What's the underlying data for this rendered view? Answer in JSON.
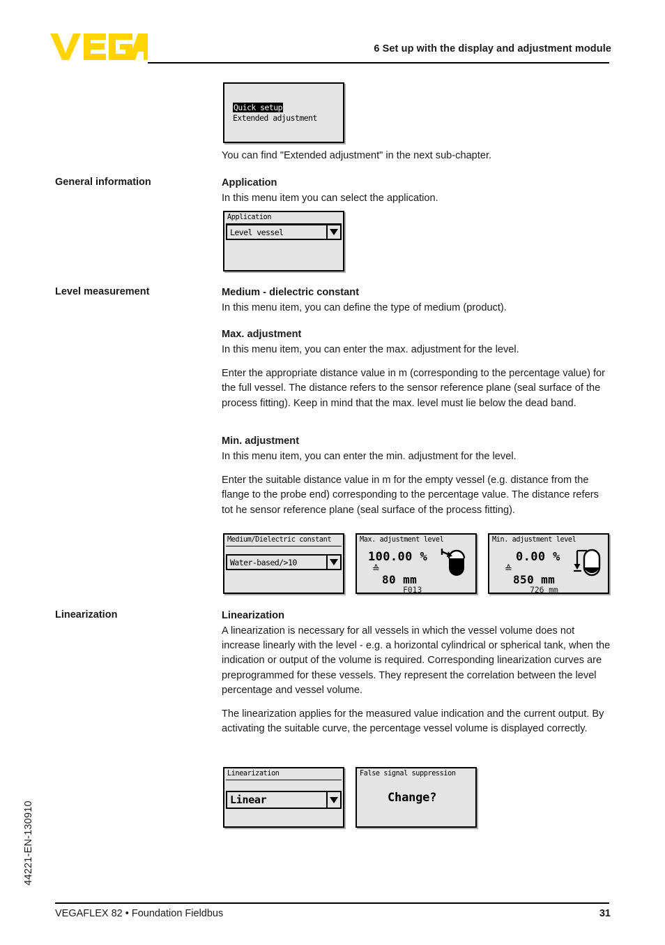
{
  "header": {
    "logo_text": "VEGA",
    "logo_color": "#FFD400",
    "chapter_title": "6 Set up with the display and adjustment module"
  },
  "displays": {
    "quick_setup": {
      "items": [
        {
          "label": "Quick setup",
          "selected": true
        },
        {
          "label": "Extended adjustment",
          "selected": false
        }
      ]
    },
    "application": {
      "title": "Application",
      "value": "Level vessel",
      "caret_icon": "chevron-down-icon"
    },
    "medium": {
      "title": "Medium/Dielectric constant",
      "value": "Water-based/>10",
      "caret_icon": "chevron-down-icon"
    },
    "max_adjustment": {
      "title": "Max. adjustment level",
      "percent": "100.00 %",
      "equiv": "≙",
      "distance": "80  mm",
      "code": "F013",
      "vessel_icon": "vessel-full-icon"
    },
    "min_adjustment": {
      "title": "Min. adjustment level",
      "percent": "0.00 %",
      "equiv": "≙",
      "distance": "850  mm",
      "code": "726  mm",
      "vessel_icon": "vessel-empty-icon"
    },
    "linearization": {
      "title": "Linearization",
      "value": "Linear",
      "caret_icon": "chevron-down-icon"
    },
    "false_signal": {
      "title": "False signal suppression",
      "prompt": "Change?"
    }
  },
  "content": {
    "intro_line": "You can find \"Extended adjustment\" in the next sub-chapter.",
    "sections": [
      {
        "side_label": "General information",
        "heading": "Application",
        "paragraphs": [
          "In this menu item you can select the application."
        ]
      },
      {
        "side_label": "Level measurement",
        "heading": "Medium - dielectric constant",
        "paragraphs": [
          "In this menu item, you can define the type of medium (product)."
        ]
      },
      {
        "side_label": "",
        "heading": "Max. adjustment",
        "paragraphs": [
          "In this menu item, you can enter the max. adjustment for the level.",
          "Enter the appropriate distance value in m (corresponding to the percentage value) for the full vessel. The distance refers to the sensor reference plane (seal surface of the process fitting). Keep in mind that the max. level must lie below the dead band."
        ]
      },
      {
        "side_label": "",
        "heading": "Min. adjustment",
        "paragraphs": [
          "In this menu item, you can enter the min. adjustment for the level.",
          "Enter the suitable distance value in m for the empty vessel (e.g. distance from the flange to the probe end) corresponding to the percentage value. The distance refers tot he sensor reference plane (seal surface of the process fitting)."
        ]
      },
      {
        "side_label": "Linearization",
        "heading": "Linearization",
        "paragraphs": [
          "A linearization is necessary for all vessels in which the vessel volume does not increase linearly with the level - e.g. a horizontal cylindrical or spherical tank, when the indication or output of the volume is required. Corresponding linearization curves are preprogrammed for these vessels. They represent the correlation between the level percentage and vessel volume.",
          "The linearization applies for the measured value indication and the current output. By activating the suitable curve, the percentage vessel volume is displayed correctly."
        ]
      }
    ]
  },
  "footer": {
    "doc_code": "44221-EN-130910",
    "product_line": "VEGAFLEX 82 • Foundation Fieldbus",
    "page_number": "31"
  }
}
